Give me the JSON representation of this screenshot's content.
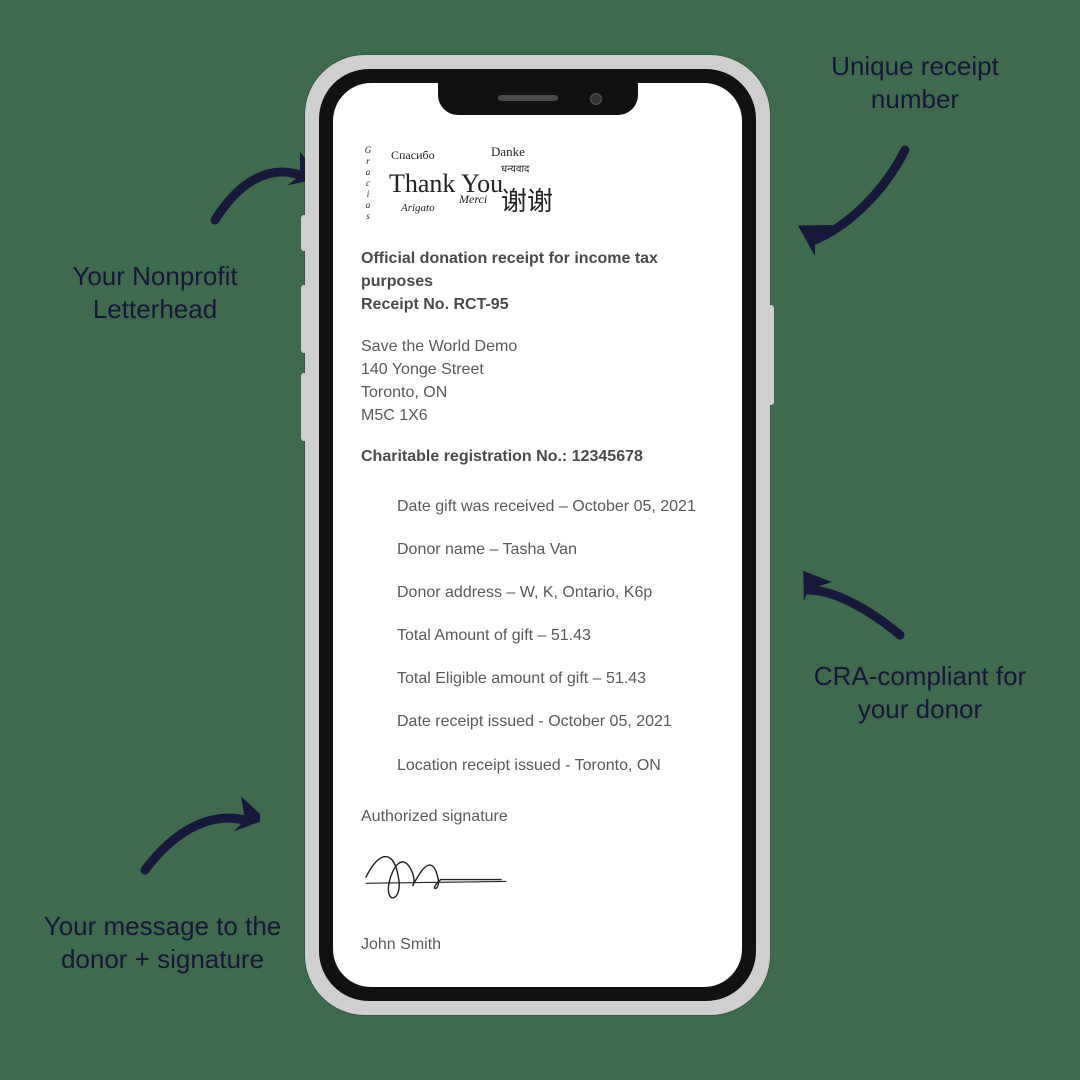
{
  "callouts": {
    "letterhead": "Your Nonprofit Letterhead",
    "receipt_no": "Unique receipt number",
    "cra": "CRA-compliant for your donor",
    "message": "Your message to the donor + signature"
  },
  "letterhead": {
    "gracias": "Gracias",
    "spasibo": "Спасибо",
    "danke": "Danke",
    "dhanyavad": "धन्यवाद",
    "thank_you": "Thank You",
    "merci": "Merci",
    "arigato": "Arigato",
    "xiexie": "谢谢"
  },
  "receipt": {
    "title_line1": "Official donation receipt for income tax purposes",
    "title_line2_label": "Receipt No.",
    "receipt_no": "RCT-95",
    "org_name": "Save the World Demo",
    "address_line1": "140 Yonge Street",
    "address_line2": "Toronto, ON",
    "postal": "M5C 1X6",
    "reg_label": "Charitable registration No.:",
    "reg_no": "12345678",
    "rows": {
      "date_received_label": "Date gift was received –",
      "date_received": "October 05, 2021",
      "donor_name_label": "Donor name –",
      "donor_name": "Tasha Van",
      "donor_address_label": "Donor address –",
      "donor_address": "W, K, Ontario, K6p",
      "total_amount_label": "Total Amount of gift –",
      "total_amount": "51.43",
      "eligible_label": "Total Eligible amount of gift –",
      "eligible_amount": "51.43",
      "date_issued_label": "Date receipt issued -",
      "date_issued": "October 05, 2021",
      "location_label": "Location receipt issued -",
      "location": "Toronto, ON"
    },
    "sig_label": "Authorized signature",
    "signer": "John Smith"
  }
}
